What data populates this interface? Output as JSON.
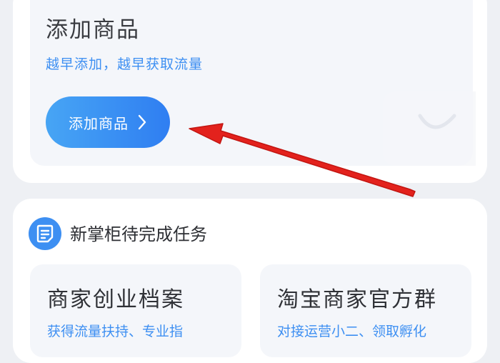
{
  "add_product": {
    "title": "添加商品",
    "subtitle": "越早添加，越早获取流量",
    "button_label": "添加商品"
  },
  "tasks": {
    "title": "新掌柜待完成任务",
    "cards": [
      {
        "title": "商家创业档案",
        "subtitle": "获得流量扶持、专业指"
      },
      {
        "title": "淘宝商家官方群",
        "subtitle": "对接运营小二、领取孵化"
      }
    ]
  },
  "colors": {
    "accent_blue": "#3d8ff2",
    "arrow_red": "#e3221d",
    "page_background": "#eef0f4"
  },
  "icons": {
    "button_chevron": "chevron-right-icon",
    "task_header": "document-list-icon",
    "annotation": "red-arrow-annotation"
  }
}
